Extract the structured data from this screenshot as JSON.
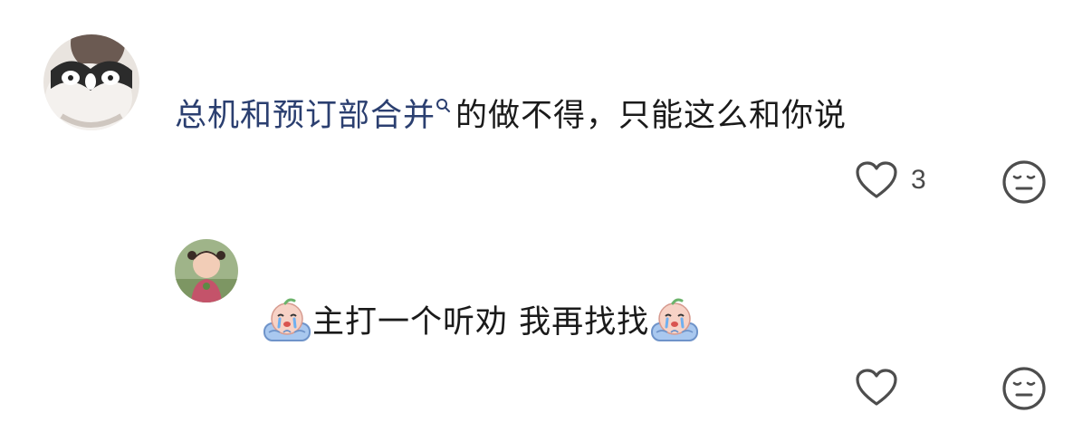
{
  "comments": [
    {
      "keyword": "总机和预订部合并",
      "text": "的做不得，只能这么和你说",
      "like_count": "3",
      "icons": {
        "like": "heart-icon",
        "dislike": "meh-face-icon",
        "search": "search-icon"
      }
    },
    {
      "text": "主打一个听劝 我再找找",
      "like_count": "",
      "icons": {
        "like": "heart-icon",
        "dislike": "meh-face-icon",
        "emoji": "crying-emoji-icon"
      }
    }
  ],
  "colors": {
    "keyword": "#2b3f70",
    "icon_stroke": "#4d4d4d",
    "text": "#1a1a1a"
  }
}
